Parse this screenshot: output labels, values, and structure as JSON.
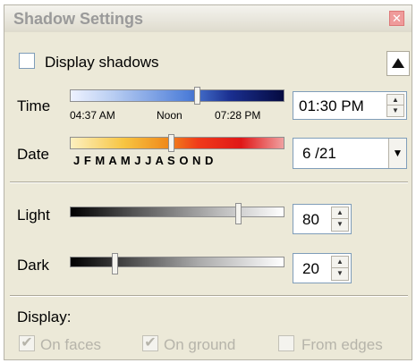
{
  "window": {
    "title": "Shadow Settings"
  },
  "display_shadows": {
    "label": "Display shadows",
    "checked": false
  },
  "time": {
    "label": "Time",
    "ticks": [
      "04:37 AM",
      "Noon",
      "07:28 PM"
    ],
    "value": "01:30 PM"
  },
  "date": {
    "label": "Date",
    "months": "J F M A M J J A S O N D",
    "value": "6 /21"
  },
  "light": {
    "label": "Light",
    "value": "80"
  },
  "dark": {
    "label": "Dark",
    "value": "20"
  },
  "display": {
    "label": "Display:",
    "on_faces": {
      "label": "On faces",
      "checked": true
    },
    "on_ground": {
      "label": "On ground",
      "checked": true
    },
    "from_edges": {
      "label": "From edges",
      "checked": false
    }
  },
  "icons": {
    "close": "close-icon",
    "collapse": "triangle-up-icon",
    "dropdown": "chevron-down-icon",
    "spin_up": "spin-up-icon",
    "spin_down": "spin-down-icon"
  }
}
